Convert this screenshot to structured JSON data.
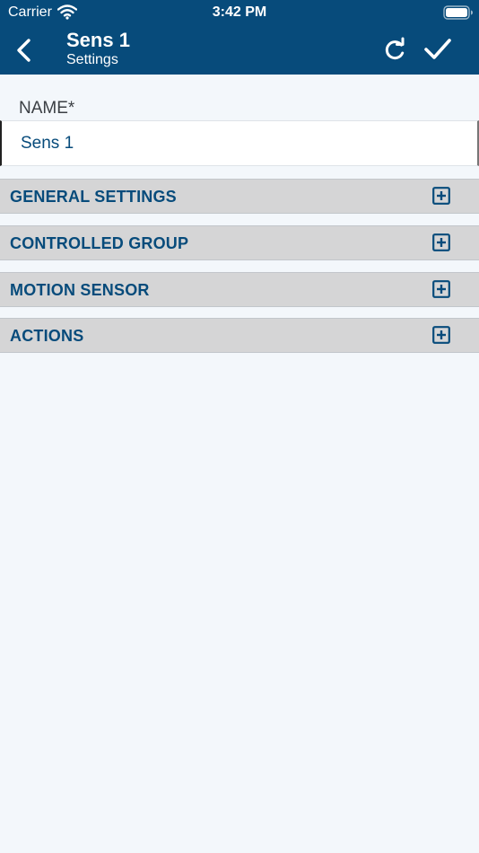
{
  "status_bar": {
    "carrier": "Carrier",
    "time": "3:42 PM",
    "wifi_icon": "wifi-icon",
    "battery_icon": "battery-full-icon"
  },
  "nav": {
    "title": "Sens 1",
    "subtitle": "Settings",
    "back_icon": "chevron-left-icon",
    "refresh_icon": "refresh-icon",
    "save_icon": "checkmark-icon"
  },
  "form": {
    "name_label": "NAME*",
    "name_value": "Sens 1"
  },
  "sections": [
    {
      "label": "GENERAL SETTINGS",
      "icon": "plus-square-icon",
      "expanded": false
    },
    {
      "label": "CONTROLLED GROUP",
      "icon": "plus-square-icon",
      "expanded": false
    },
    {
      "label": "MOTION SENSOR",
      "icon": "plus-square-icon",
      "expanded": false
    },
    {
      "label": "ACTIONS",
      "icon": "plus-square-icon",
      "expanded": false
    }
  ],
  "colors": {
    "header_bg": "#074b7b",
    "accent": "#074b7b",
    "page_bg": "#f3f7fb",
    "section_bg": "#d5d5d6",
    "field_bg": "#ffffff"
  }
}
